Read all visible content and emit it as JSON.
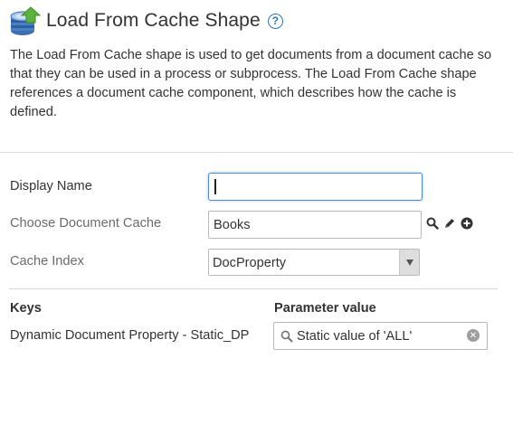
{
  "header": {
    "title": "Load From Cache Shape",
    "help_icon": "question-circle-icon",
    "shape_icon": "cache-cylinder-upload-icon"
  },
  "description": "The Load From Cache shape is used to get documents from a document cache so that they can be used in a process or subprocess. The Load From Cache shape references a document cache component, which describes how the cache is defined.",
  "form": {
    "display_name": {
      "label": "Display Name",
      "value": ""
    },
    "document_cache": {
      "label": "Choose Document Cache",
      "value": "Books",
      "tools": [
        "search-icon",
        "pencil-icon",
        "plus-circle-icon"
      ]
    },
    "cache_index": {
      "label": "Cache Index",
      "selected": "DocProperty"
    }
  },
  "keys_table": {
    "headers": {
      "keys": "Keys",
      "parameter_value": "Parameter value"
    },
    "rows": [
      {
        "key": "Dynamic Document Property - Static_DP",
        "parameter_value": "Static value of 'ALL'"
      }
    ]
  },
  "colors": {
    "accent": "#2f76b6",
    "focus_border": "#4f8cc9",
    "muted_label": "#6b6b6b"
  }
}
